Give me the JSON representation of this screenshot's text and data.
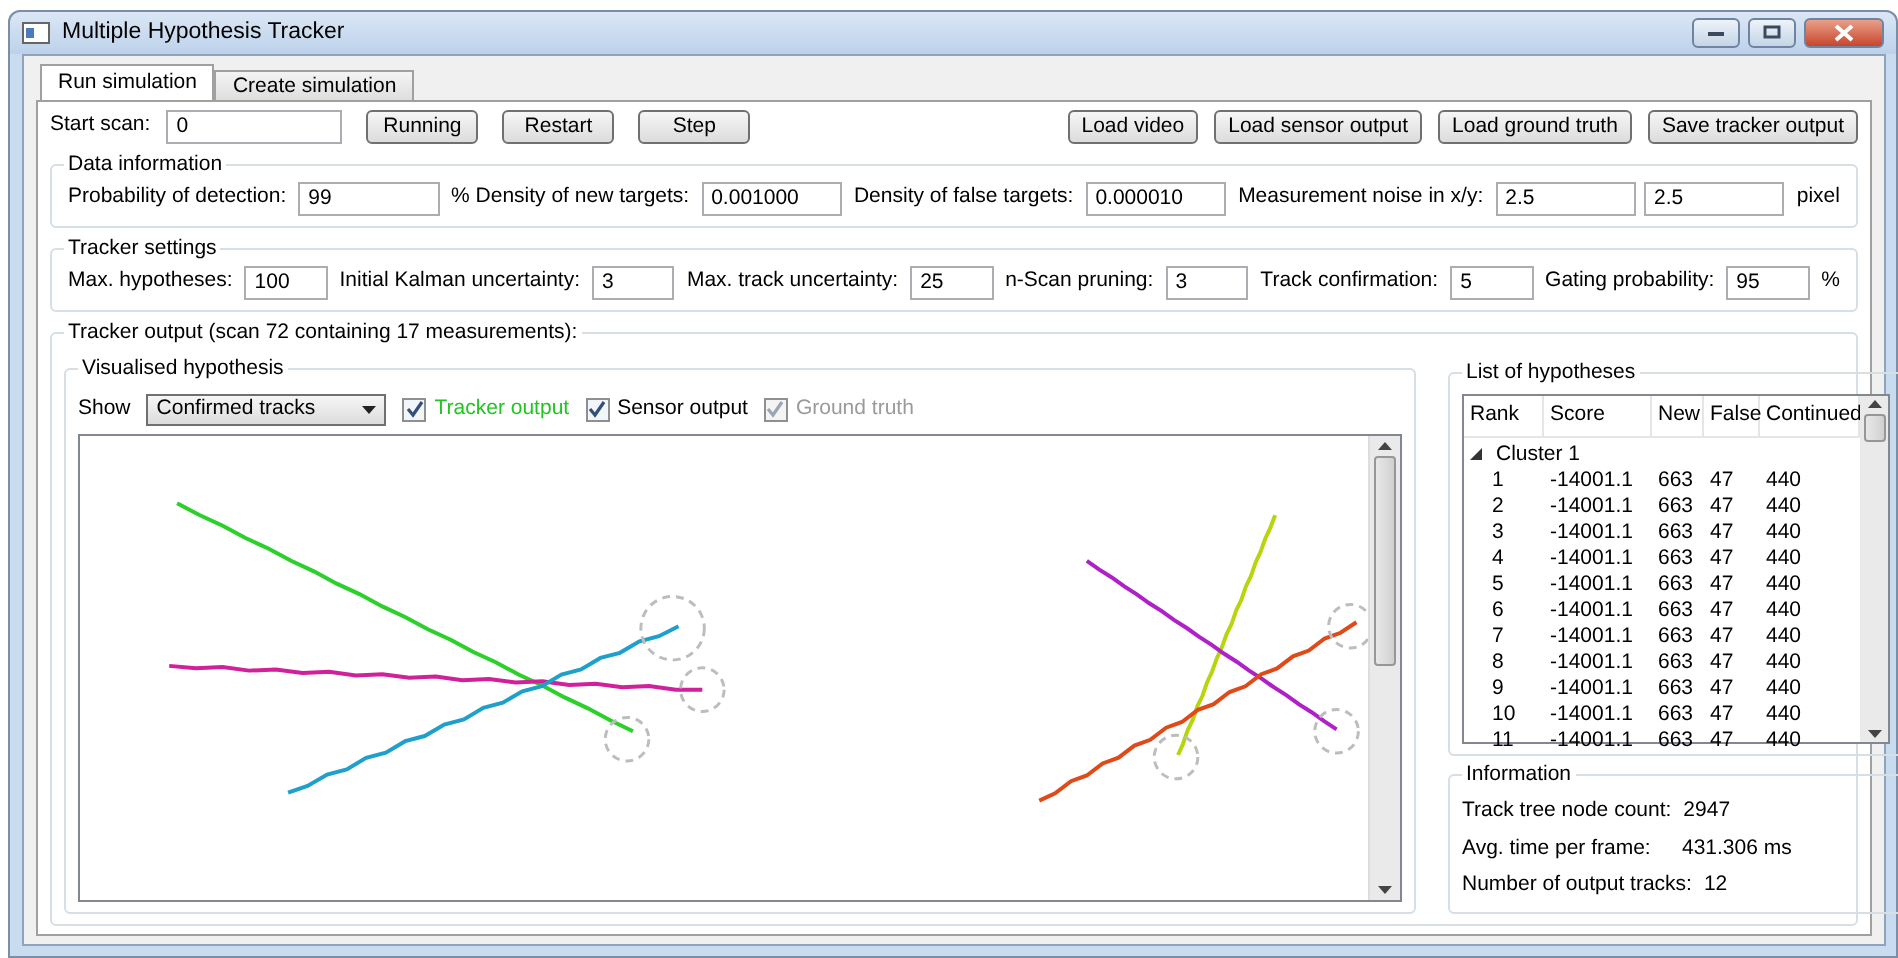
{
  "window": {
    "title": "Multiple Hypothesis Tracker"
  },
  "tabs": [
    {
      "label": "Run simulation",
      "selected": true
    },
    {
      "label": "Create simulation",
      "selected": false
    }
  ],
  "toolbar": {
    "start_scan": {
      "label": "Start scan:",
      "value": "0"
    },
    "left_buttons": [
      "Running",
      "Restart",
      "Step"
    ],
    "right_buttons": [
      "Load video",
      "Load sensor output",
      "Load ground truth",
      "Save tracker output"
    ]
  },
  "data_information": {
    "title": "Data information",
    "items": [
      {
        "kind": "label",
        "text": "Probability of detection:"
      },
      {
        "kind": "input",
        "value": "99"
      },
      {
        "kind": "label",
        "text": "%  Density of new targets:"
      },
      {
        "kind": "input",
        "value": "0.001000"
      },
      {
        "kind": "label",
        "text": "Density of false targets:"
      },
      {
        "kind": "input",
        "value": "0.000010"
      },
      {
        "kind": "label",
        "text": "Measurement noise in x/y:"
      },
      {
        "kind": "input",
        "value": "2.5"
      },
      {
        "kind": "input",
        "value": "2.5"
      },
      {
        "kind": "label",
        "text": "pixel"
      }
    ]
  },
  "tracker_settings": {
    "title": "Tracker settings",
    "items": [
      {
        "kind": "label",
        "text": "Max. hypotheses:"
      },
      {
        "kind": "input",
        "value": "100"
      },
      {
        "kind": "label",
        "text": "Initial Kalman uncertainty:"
      },
      {
        "kind": "input",
        "value": "3"
      },
      {
        "kind": "label",
        "text": "Max. track uncertainty:"
      },
      {
        "kind": "input",
        "value": "25"
      },
      {
        "kind": "label",
        "text": "n-Scan pruning:"
      },
      {
        "kind": "input",
        "value": "3"
      },
      {
        "kind": "label",
        "text": "Track confirmation:"
      },
      {
        "kind": "input",
        "value": "5"
      },
      {
        "kind": "label",
        "text": "Gating probability:"
      },
      {
        "kind": "input",
        "value": "95"
      },
      {
        "kind": "label",
        "text": "%"
      }
    ]
  },
  "tracker_output": {
    "title": "Tracker output (scan 72 containing 17 measurements):",
    "visualised": {
      "title": "Visualised hypothesis",
      "show_label": "Show",
      "show_value": "Confirmed tracks",
      "checkboxes": [
        {
          "label": "Tracker output",
          "checked": true,
          "disabled": false,
          "color": "#22c422"
        },
        {
          "label": "Sensor output",
          "checked": true,
          "disabled": false
        },
        {
          "label": "Ground truth",
          "checked": true,
          "disabled": true
        }
      ]
    },
    "hypotheses": {
      "title": "List of hypotheses",
      "columns": [
        "Rank",
        "Score",
        "New",
        "False",
        "Continued"
      ],
      "clusters": [
        {
          "label": "Cluster 1",
          "expanded": true,
          "children": [
            {
              "rank": "1",
              "score": "-14001.1",
              "new": "663",
              "false": "47",
              "continued": "440"
            },
            {
              "rank": "2",
              "score": "-14001.1",
              "new": "663",
              "false": "47",
              "continued": "440"
            },
            {
              "rank": "3",
              "score": "-14001.1",
              "new": "663",
              "false": "47",
              "continued": "440"
            },
            {
              "rank": "4",
              "score": "-14001.1",
              "new": "663",
              "false": "47",
              "continued": "440"
            },
            {
              "rank": "5",
              "score": "-14001.1",
              "new": "663",
              "false": "47",
              "continued": "440"
            },
            {
              "rank": "6",
              "score": "-14001.1",
              "new": "663",
              "false": "47",
              "continued": "440"
            },
            {
              "rank": "7",
              "score": "-14001.1",
              "new": "663",
              "false": "47",
              "continued": "440"
            },
            {
              "rank": "8",
              "score": "-14001.1",
              "new": "663",
              "false": "47",
              "continued": "440"
            },
            {
              "rank": "9",
              "score": "-14001.1",
              "new": "663",
              "false": "47",
              "continued": "440"
            },
            {
              "rank": "10",
              "score": "-14001.1",
              "new": "663",
              "false": "47",
              "continued": "440"
            },
            {
              "rank": "11",
              "score": "-14001.1",
              "new": "663",
              "false": "47",
              "continued": "440"
            }
          ]
        }
      ]
    },
    "information": {
      "title": "Information",
      "rows": [
        {
          "label": "Track tree node count:",
          "value": "2947"
        },
        {
          "label": "Avg. time per frame:",
          "value": "431.306 ms"
        },
        {
          "label": "Number of output tracks:",
          "value": "12"
        }
      ]
    }
  }
}
